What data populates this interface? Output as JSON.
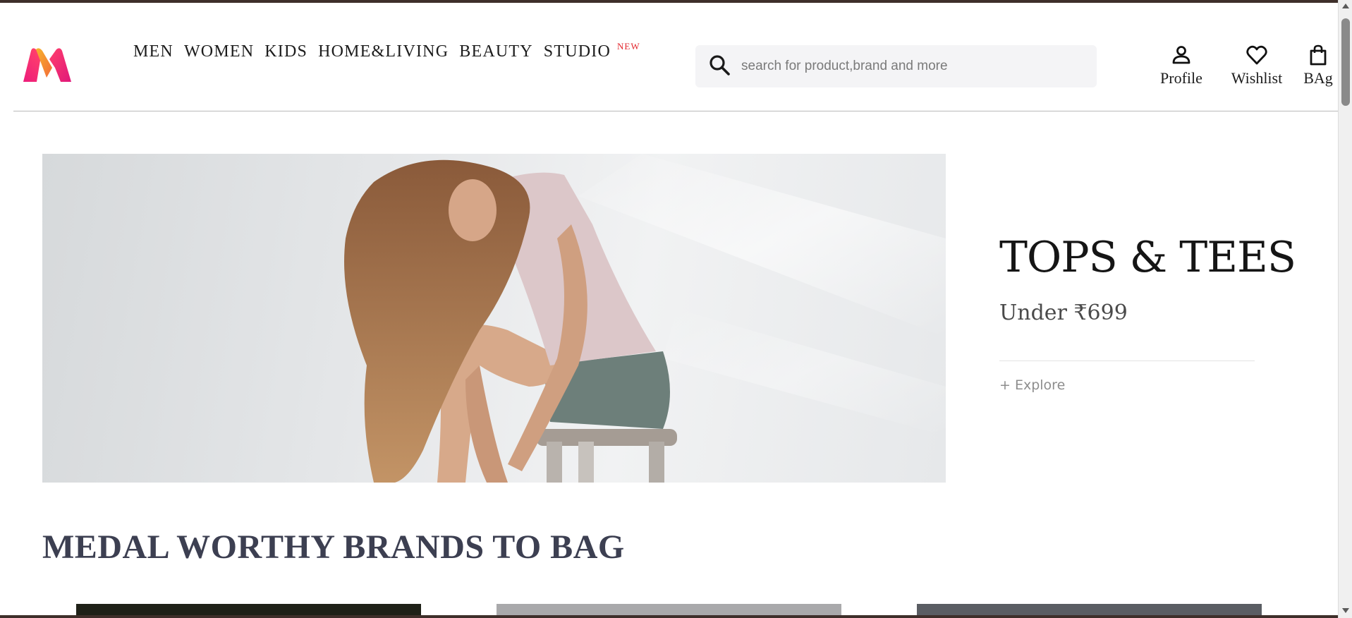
{
  "header": {
    "logo_icon": "myntra-m-logo",
    "nav": [
      "MEN",
      "WOMEN",
      "KIDS",
      "HOME&LIVING",
      "BEAUTY",
      "STUDIO"
    ],
    "nav_badge": "NEW",
    "search": {
      "icon": "search-icon",
      "placeholder": "search for product,brand and more",
      "value": ""
    },
    "actions": [
      {
        "label": "Profile",
        "icon": "profile-icon"
      },
      {
        "label": "Wishlist",
        "icon": "heart-icon"
      },
      {
        "label": "BAg",
        "icon": "bag-icon"
      }
    ]
  },
  "hero": {
    "image": "model-seated-on-stool-photo",
    "title": "TOPS & TEES",
    "subtitle": "Under ₹699",
    "cta": "+ Explore"
  },
  "section": {
    "title": "MEDAL WORTHY BRANDS TO BAG"
  },
  "colors": {
    "brand_gradient": [
      "#ff3f6c",
      "#f7832f",
      "#ff5fa2"
    ],
    "nav_new": "#e2262c",
    "section_title": "#3c3f51",
    "search_bg": "#f4f4f6"
  }
}
